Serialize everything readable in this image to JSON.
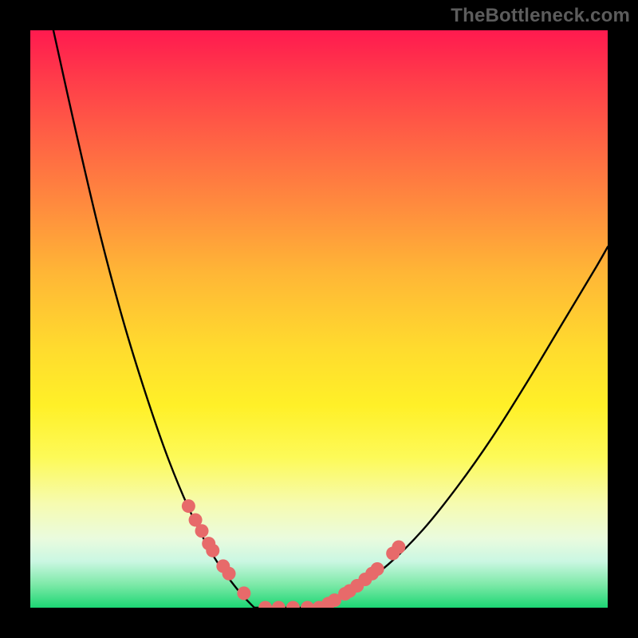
{
  "watermark": "TheBottleneck.com",
  "chart_data": {
    "type": "line",
    "title": "",
    "xlabel": "",
    "ylabel": "",
    "xlim": [
      0,
      1
    ],
    "ylim": [
      0,
      1
    ],
    "legend": "none",
    "grid": false,
    "series": [
      {
        "name": "left-curve",
        "x": [
          0.04,
          0.08,
          0.12,
          0.16,
          0.2,
          0.24,
          0.28,
          0.32,
          0.36,
          0.388
        ],
        "y": [
          1.0,
          0.82,
          0.65,
          0.5,
          0.37,
          0.255,
          0.16,
          0.085,
          0.03,
          0.0
        ]
      },
      {
        "name": "flat-bottom",
        "x": [
          0.388,
          0.5
        ],
        "y": [
          0.0,
          0.0
        ]
      },
      {
        "name": "right-curve",
        "x": [
          0.5,
          0.56,
          0.62,
          0.68,
          0.74,
          0.8,
          0.86,
          0.92,
          0.98,
          1.0
        ],
        "y": [
          0.0,
          0.03,
          0.075,
          0.135,
          0.21,
          0.295,
          0.39,
          0.49,
          0.59,
          0.625
        ]
      }
    ],
    "scatter": [
      {
        "name": "left-beads",
        "x": [
          0.274,
          0.286,
          0.297,
          0.309,
          0.316,
          0.334,
          0.344,
          0.37,
          0.407,
          0.43,
          0.455,
          0.48
        ],
        "y": [
          0.176,
          0.152,
          0.133,
          0.111,
          0.099,
          0.072,
          0.059,
          0.025,
          0.0,
          0.0,
          0.0,
          0.0
        ]
      },
      {
        "name": "right-beads",
        "x": [
          0.5,
          0.516,
          0.527,
          0.545,
          0.553,
          0.566,
          0.58,
          0.592,
          0.601,
          0.628,
          0.638
        ],
        "y": [
          0.0,
          0.007,
          0.013,
          0.024,
          0.029,
          0.038,
          0.049,
          0.059,
          0.067,
          0.094,
          0.105
        ]
      }
    ],
    "colors": {
      "curve": "#000000",
      "beads": "#e76a6a"
    }
  }
}
